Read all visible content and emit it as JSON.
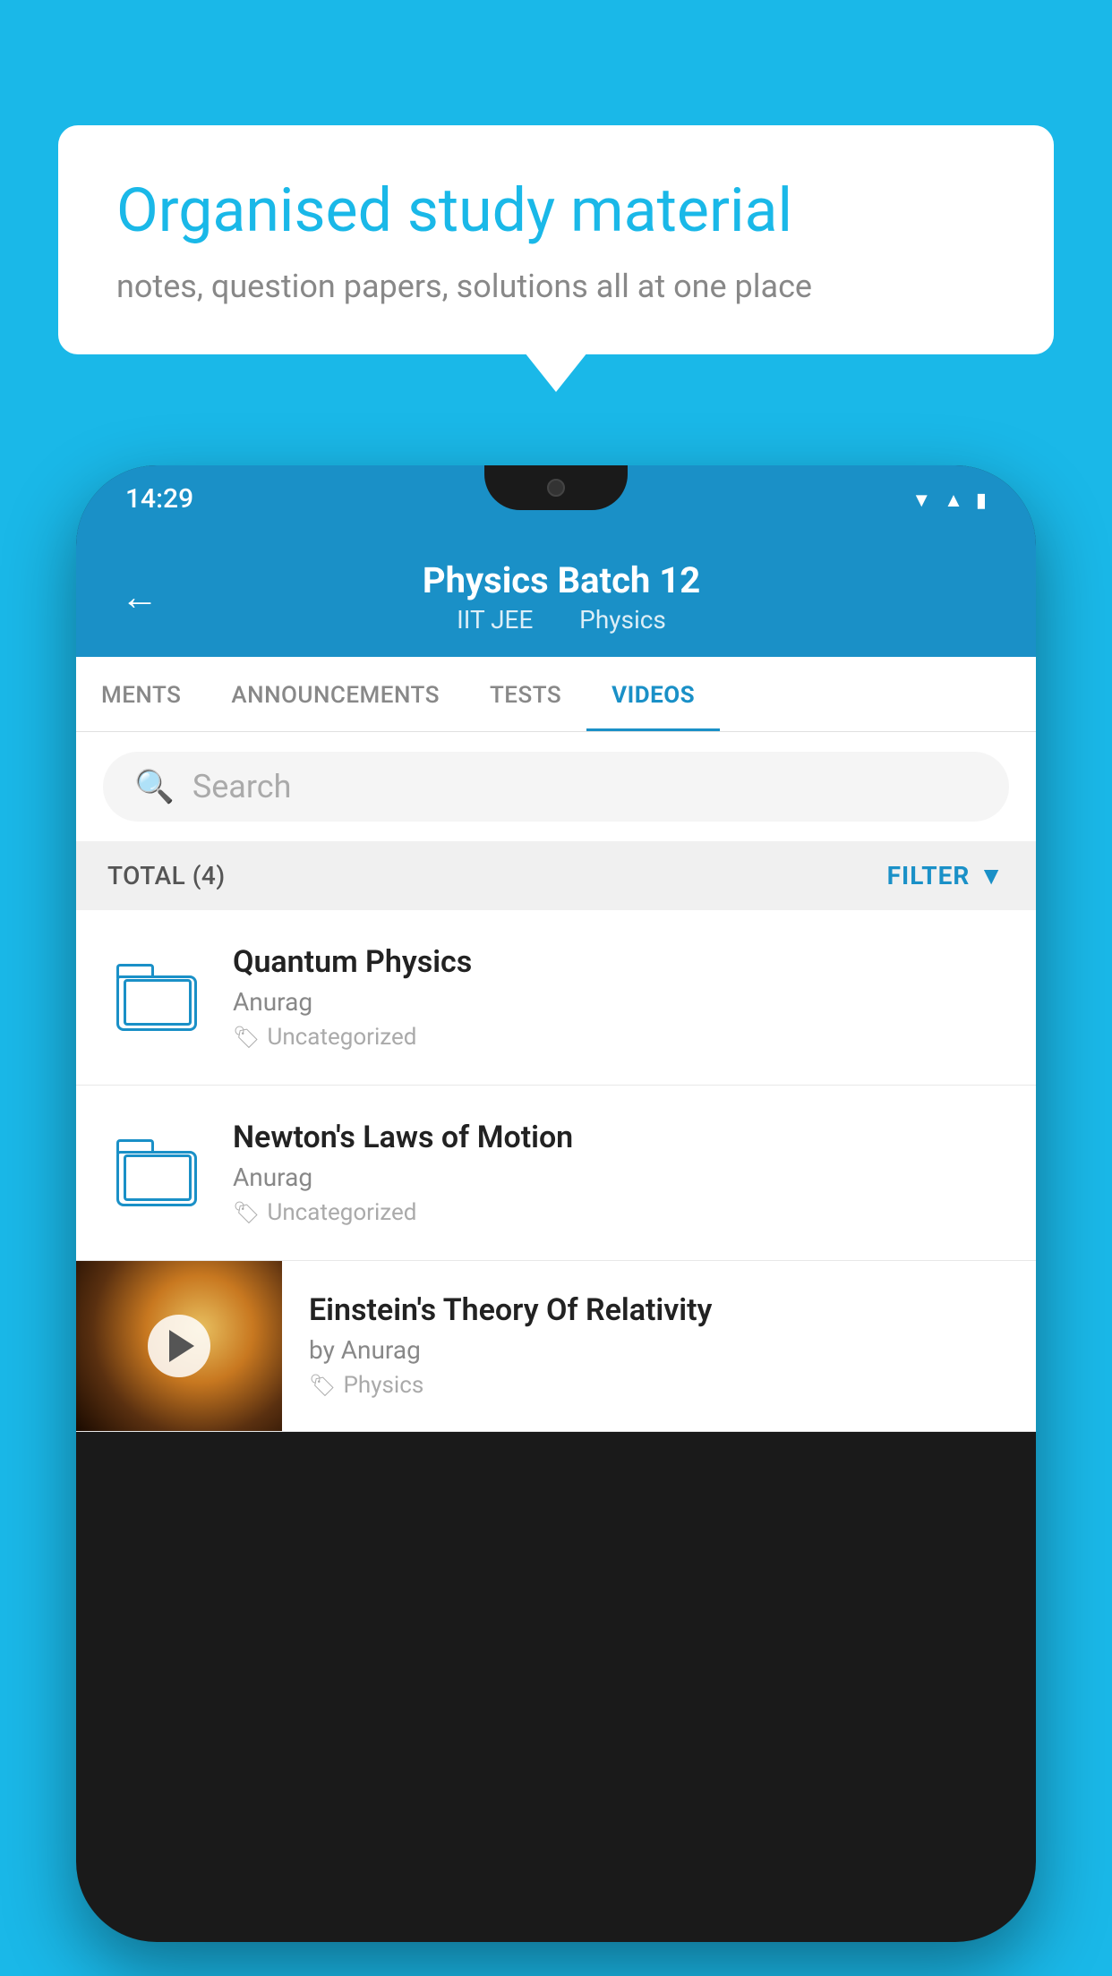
{
  "background": {
    "color": "#1ab8e8"
  },
  "speech_bubble": {
    "title": "Organised study material",
    "subtitle": "notes, question papers, solutions all at one place"
  },
  "phone": {
    "status_bar": {
      "time": "14:29"
    },
    "app_header": {
      "title": "Physics Batch 12",
      "tag1": "IIT JEE",
      "tag2": "Physics",
      "back_label": "←"
    },
    "tabs": [
      {
        "label": "MENTS",
        "active": false
      },
      {
        "label": "ANNOUNCEMENTS",
        "active": false
      },
      {
        "label": "TESTS",
        "active": false
      },
      {
        "label": "VIDEOS",
        "active": true
      }
    ],
    "search": {
      "placeholder": "Search"
    },
    "filter_row": {
      "total_label": "TOTAL (4)",
      "filter_label": "FILTER"
    },
    "videos": [
      {
        "id": 1,
        "title": "Quantum Physics",
        "author": "Anurag",
        "category": "Uncategorized",
        "has_thumbnail": false
      },
      {
        "id": 2,
        "title": "Newton's Laws of Motion",
        "author": "Anurag",
        "category": "Uncategorized",
        "has_thumbnail": false
      },
      {
        "id": 3,
        "title": "Einstein's Theory Of Relativity",
        "author": "by Anurag",
        "category": "Physics",
        "has_thumbnail": true
      }
    ]
  }
}
